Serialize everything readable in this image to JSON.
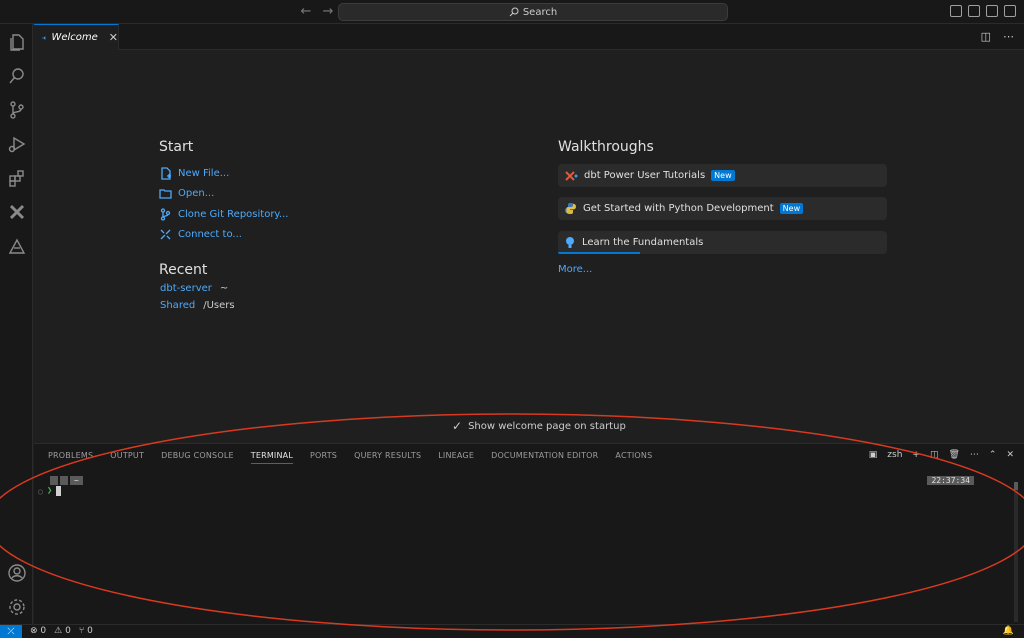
{
  "titlebar": {
    "back_glyph": "←",
    "forward_glyph": "→",
    "search_placeholder": "Search"
  },
  "tabs": [
    {
      "label": "Welcome",
      "close_glyph": "✕"
    }
  ],
  "welcome": {
    "start_title": "Start",
    "start_items": [
      {
        "label": "New File...",
        "icon": "new-file-icon"
      },
      {
        "label": "Open...",
        "icon": "folder-icon"
      },
      {
        "label": "Clone Git Repository...",
        "icon": "source-control-icon"
      },
      {
        "label": "Connect to...",
        "icon": "remote-icon"
      }
    ],
    "recent_title": "Recent",
    "recent_items": [
      {
        "name": "dbt-server",
        "path": "~"
      },
      {
        "name": "Shared",
        "path": "/Users"
      }
    ],
    "walkthroughs_title": "Walkthroughs",
    "walkthroughs": [
      {
        "label": "dbt Power User Tutorials",
        "badge": "New",
        "icon": "dbt-icon"
      },
      {
        "label": "Get Started with Python Development",
        "badge": "New",
        "icon": "python-icon"
      },
      {
        "label": "Learn the Fundamentals",
        "badge": "",
        "icon": "lightbulb-icon",
        "progress_fraction": 0.25
      }
    ],
    "more_label": "More...",
    "show_on_startup_label": "Show welcome page on startup",
    "show_on_startup_checked": true
  },
  "panel": {
    "tabs": [
      "PROBLEMS",
      "OUTPUT",
      "DEBUG CONSOLE",
      "TERMINAL",
      "PORTS",
      "QUERY RESULTS",
      "LINEAGE",
      "DOCUMENTATION EDITOR",
      "ACTIONS"
    ],
    "active_tab": "TERMINAL",
    "shell_name": "zsh",
    "terminal": {
      "prompt_segments": [
        "",
        "",
        "~"
      ],
      "time": "22:37:34",
      "arrow": "❯"
    }
  },
  "statusbar": {
    "errors": "0",
    "warnings": "0",
    "ports": "0"
  },
  "colors": {
    "accent": "#0078d4",
    "link": "#4daafc",
    "annotation": "#d93a1f"
  }
}
